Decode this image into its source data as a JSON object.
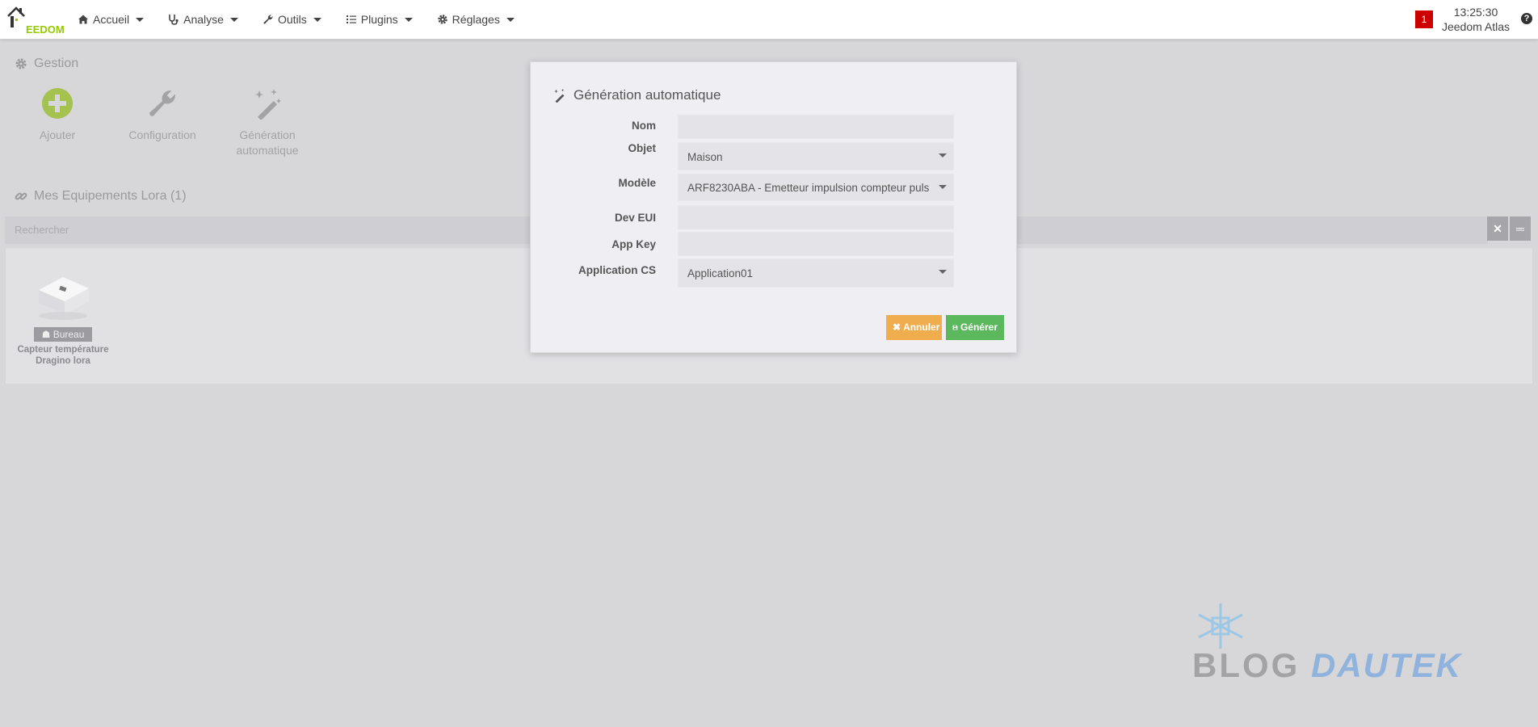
{
  "navbar": {
    "logo_text": "EEDOM",
    "menu": [
      {
        "label": "Accueil",
        "icon": "home-icon"
      },
      {
        "label": "Analyse",
        "icon": "stethoscope-icon"
      },
      {
        "label": "Outils",
        "icon": "wrench-icon"
      },
      {
        "label": "Plugins",
        "icon": "list-icon"
      },
      {
        "label": "Réglages",
        "icon": "gear-icon"
      }
    ],
    "notification_count": "1",
    "time": "13:25:30",
    "system_name": "Jeedom Atlas",
    "help_glyph": "?"
  },
  "gestion": {
    "title": "Gestion",
    "tiles": [
      {
        "label": "Ajouter",
        "icon": "plus-circle-icon"
      },
      {
        "label": "Configuration",
        "icon": "wrench-icon"
      },
      {
        "label_line1": "Génération",
        "label_line2": "automatique",
        "icon": "magic-wand-icon"
      }
    ]
  },
  "equipments": {
    "title": "Mes Equipements Lora (1)",
    "search_placeholder": "Rechercher",
    "clear_glyph": "✕",
    "toggle_glyph": "═",
    "items": [
      {
        "badge": "Bureau",
        "name_line1": "Capteur température",
        "name_line2": "Dragino lora"
      }
    ]
  },
  "modal": {
    "title": "Génération automatique",
    "fields": {
      "nom": {
        "label": "Nom",
        "value": ""
      },
      "objet": {
        "label": "Objet",
        "value": "Maison"
      },
      "modele": {
        "label": "Modèle",
        "value": "ARF8230ABA - Emetteur impulsion compteur puls"
      },
      "dev_eui": {
        "label": "Dev EUI",
        "value": ""
      },
      "app_key": {
        "label": "App Key",
        "value": ""
      },
      "application_cs": {
        "label": "Application CS",
        "value": "Application01"
      }
    },
    "cancel_label": "Annuler",
    "generate_label": "Générer"
  },
  "watermark": {
    "part1": "BLOG",
    "part2": "DAUTEK"
  },
  "colors": {
    "accent_green": "#94ca02",
    "cancel": "#f0ad4e",
    "generate": "#5cb85c",
    "notification": "#cc0000"
  }
}
